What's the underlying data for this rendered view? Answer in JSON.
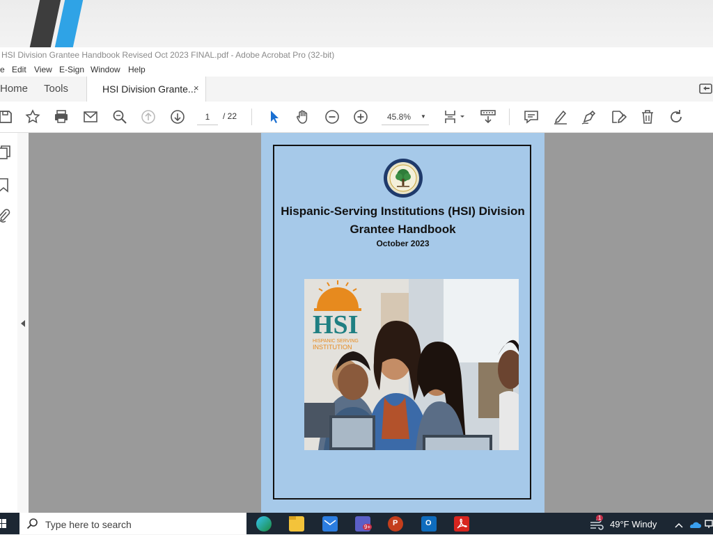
{
  "window": {
    "title": "HSI Division Grantee Handbook Revised Oct 2023 FINAL.pdf - Adobe Acrobat Pro (32-bit)"
  },
  "menu": {
    "items": [
      "e",
      "Edit",
      "View",
      "E-Sign",
      "Window",
      "Help"
    ]
  },
  "tabs": {
    "home": "Home",
    "tools": "Tools",
    "document": "HSI Division Grante...",
    "close": "×"
  },
  "toolbar": {
    "page_current": "1",
    "page_total": "/ 22",
    "zoom": "45.8%",
    "icons": [
      "save-icon",
      "bookmark-star-icon",
      "print-icon",
      "email-icon",
      "find-zoom-icon",
      "page-up-icon",
      "page-down-icon",
      "select-cursor-icon",
      "hand-tool-icon",
      "zoom-out-icon",
      "zoom-in-icon",
      "page-fit-icon",
      "scroll-mode-icon",
      "comment-icon",
      "highlight-icon",
      "sign-icon",
      "edit-pdf-icon",
      "delete-icon",
      "rotate-icon"
    ]
  },
  "document": {
    "title_line1": "Hispanic-Serving Institutions (HSI) Division",
    "title_line2": "Grantee Handbook",
    "date": "October 2023",
    "seal_text": "DEPARTMENT OF EDUCATION",
    "logo_text": "HSI",
    "logo_subtext_1": "HISPANIC SERVING",
    "logo_subtext_2": "INSTITUTION",
    "background_color": "#a6c9e9"
  },
  "taskbar": {
    "search_placeholder": "Type here to search",
    "weather": "49°F  Windy",
    "teams_badge": "9+",
    "notification_badge": "1"
  }
}
